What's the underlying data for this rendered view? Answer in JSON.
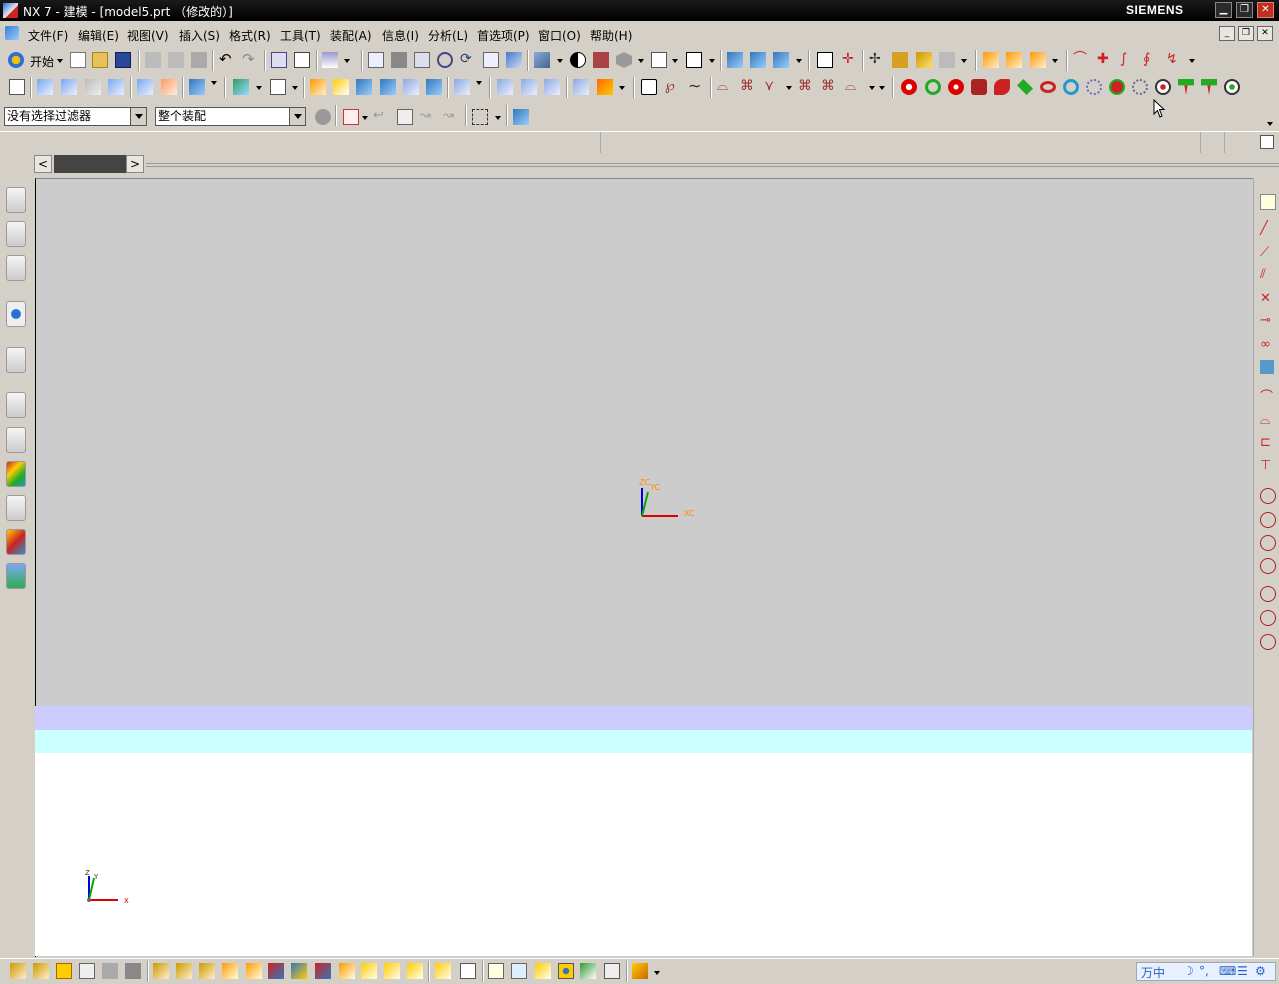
{
  "window": {
    "title": "NX 7 - 建模 - [model5.prt （修改的）]",
    "brand": "SIEMENS",
    "controls": [
      "minimize",
      "restore",
      "close"
    ]
  },
  "menubar": {
    "items": [
      "文件(F)",
      "编辑(E)",
      "视图(V)",
      "插入(S)",
      "格式(R)",
      "工具(T)",
      "装配(A)",
      "信息(I)",
      "分析(L)",
      "首选项(P)",
      "窗口(O)",
      "帮助(H)"
    ]
  },
  "toolbar": {
    "start_label": "开始"
  },
  "selection": {
    "filter": "没有选择过滤器",
    "scope": "整个装配"
  },
  "viewport": {
    "wcs_labels": {
      "z": "ZC",
      "y": "YC",
      "x": "XC"
    },
    "abs_labels": {
      "z": "Z",
      "y": "Y",
      "x": "X"
    },
    "colors": {
      "background": "#cccccc",
      "band_lavender": "#ccccff",
      "band_cyan": "#ccffff",
      "band_white": "#ffffff",
      "axis_x": "#e00000",
      "axis_y": "#00aa00",
      "axis_z": "#0000e0",
      "wcs_label": "#ff8c00"
    }
  },
  "statusbar": {
    "ime_text": "万中"
  }
}
